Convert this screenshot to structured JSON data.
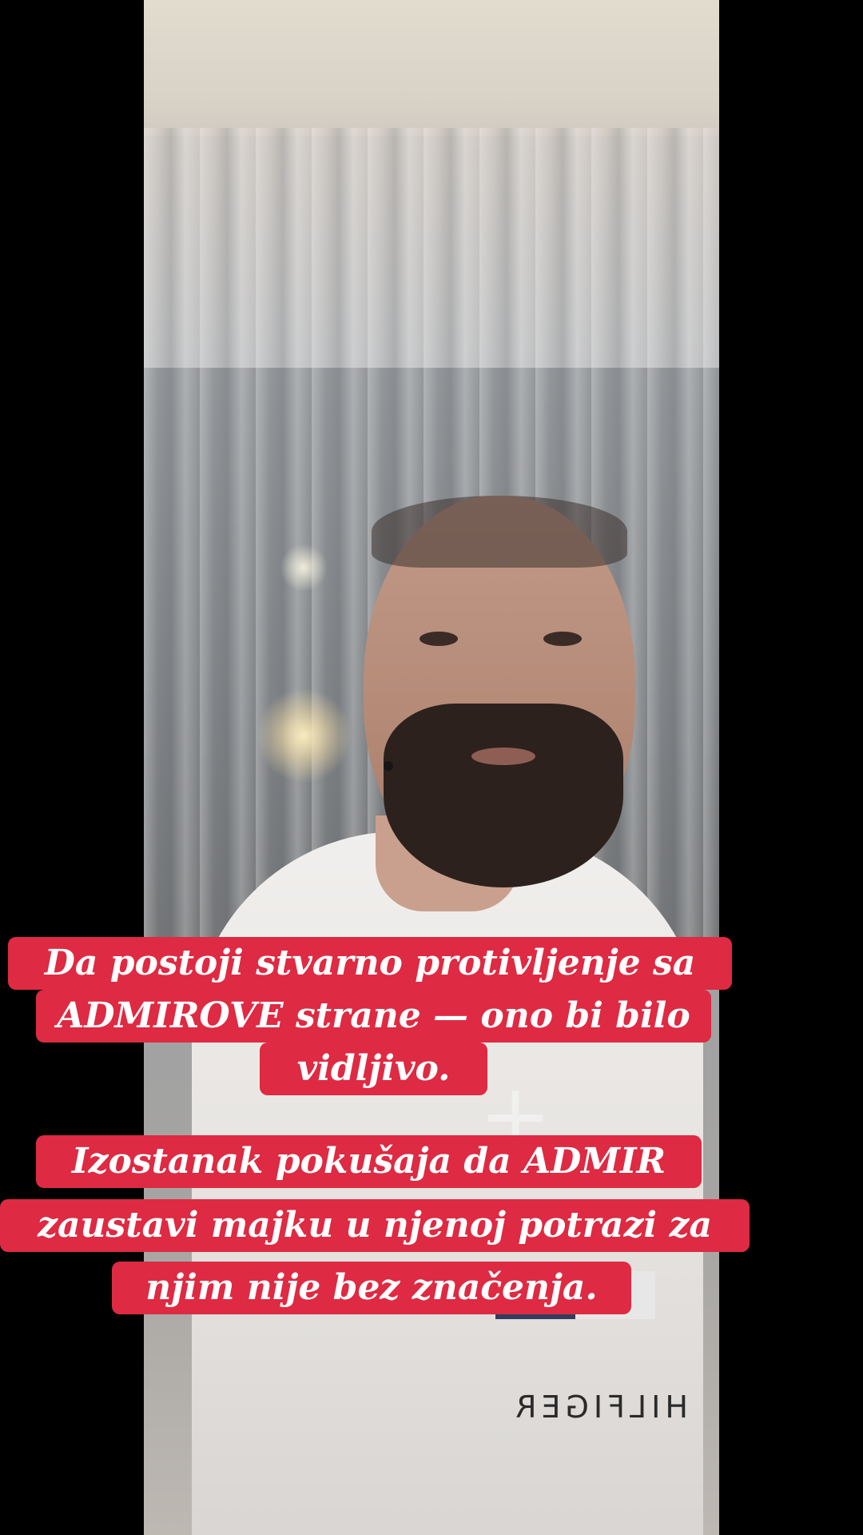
{
  "video": {
    "brand_on_hoodie": "HILFIGER",
    "icon": "plus-icon"
  },
  "caption": {
    "background_color": "#de2a42",
    "text_color": "#ffffff",
    "lines": [
      "Da postoji stvarno protivljenje sa",
      "ADMIROVE strane — ono bi bilo",
      "vidljivo.",
      "Izostanak pokušaja da ADMIR",
      "zaustavi majku u njenoj potrazi za",
      "njim nije bez značenja."
    ]
  }
}
